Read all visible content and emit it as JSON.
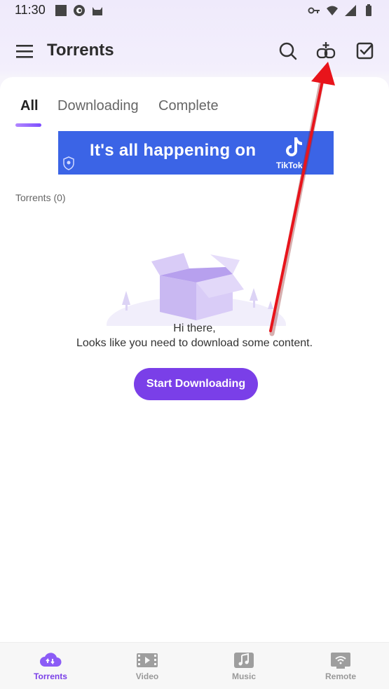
{
  "status_bar": {
    "time": "11:30",
    "left_icons": [
      "square-icon",
      "browser-icon",
      "android-cat-icon"
    ],
    "right_icons": [
      "vpn-key-icon",
      "wifi-icon",
      "signal-icon",
      "battery-icon"
    ]
  },
  "app_bar": {
    "title": "Torrents",
    "actions": [
      "search-icon",
      "add-link-icon",
      "select-check-icon"
    ]
  },
  "tabs": [
    {
      "label": "All",
      "active": true
    },
    {
      "label": "Downloading",
      "active": false
    },
    {
      "label": "Complete",
      "active": false
    }
  ],
  "ad": {
    "text": "It's all happening on",
    "brand": "TikTok"
  },
  "torrent_count": "Torrents (0)",
  "empty_state": {
    "line1": "Hi there,",
    "line2": "Looks like you need to download some content.",
    "button_label": "Start Downloading"
  },
  "bottom_nav": [
    {
      "label": "Torrents",
      "icon": "cloud-upload-icon",
      "active": true
    },
    {
      "label": "Video",
      "icon": "film-icon",
      "active": false
    },
    {
      "label": "Music",
      "icon": "music-note-icon",
      "active": false
    },
    {
      "label": "Remote",
      "icon": "remote-wifi-icon",
      "active": false
    }
  ],
  "colors": {
    "accent": "#7a3fe8",
    "ad_background": "#3b64e6",
    "annotation_arrow": "#e8141b"
  }
}
